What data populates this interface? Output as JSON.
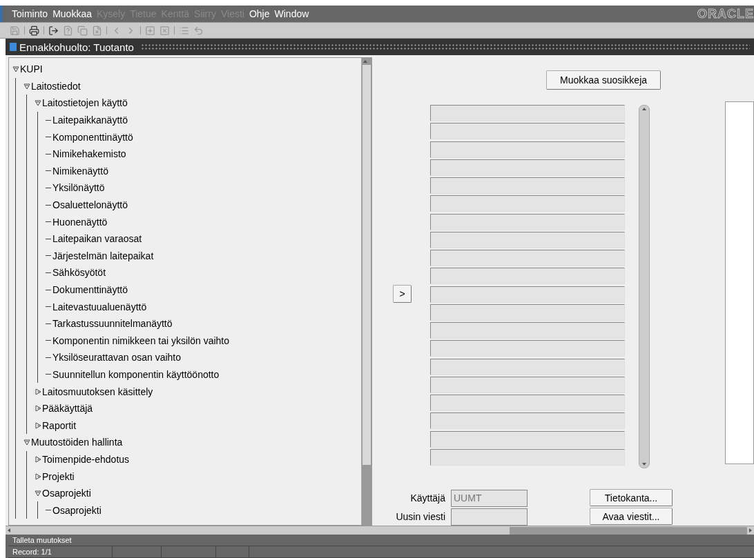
{
  "menu": [
    {
      "label": "Toiminto",
      "disabled": false
    },
    {
      "label": "Muokkaa",
      "disabled": false
    },
    {
      "label": "Kysely",
      "disabled": true
    },
    {
      "label": "Tietue",
      "disabled": true
    },
    {
      "label": "Kenttä",
      "disabled": true
    },
    {
      "label": "Siirry",
      "disabled": true
    },
    {
      "label": "Viesti",
      "disabled": true
    },
    {
      "label": "Ohje",
      "disabled": false
    },
    {
      "label": "Window",
      "disabled": false
    }
  ],
  "brand": "ORACLE",
  "window": {
    "title": "Ennakkohuolto: Tuotanto"
  },
  "tree": [
    {
      "label": "KUPI",
      "expanded": true,
      "children": [
        {
          "label": "Laitostiedot",
          "expanded": true,
          "children": [
            {
              "label": "Laitostietojen käyttö",
              "expanded": true,
              "children": [
                {
                  "label": "Laitepaikkanäyttö"
                },
                {
                  "label": "Komponenttinäyttö"
                },
                {
                  "label": "Nimikehakemisto"
                },
                {
                  "label": "Nimikenäyttö"
                },
                {
                  "label": "Yksilönäyttö"
                },
                {
                  "label": "Osaluettelonäyttö"
                },
                {
                  "label": "Huonenäyttö"
                },
                {
                  "label": "Laitepaikan varaosat"
                },
                {
                  "label": "Järjestelmän laitepaikat"
                },
                {
                  "label": "Sähkösyötöt"
                },
                {
                  "label": "Dokumenttinäyttö"
                },
                {
                  "label": "Laitevastuualuenäyttö"
                },
                {
                  "label": "Tarkastussuunnitelmanäyttö"
                },
                {
                  "label": "Komponentin nimikkeen tai yksilön vaihto"
                },
                {
                  "label": "Yksilöseurattavan osan vaihto"
                },
                {
                  "label": "Suunnitellun komponentin käyttöönotto"
                }
              ]
            },
            {
              "label": "Laitosmuutoksen käsittely",
              "expanded": false
            },
            {
              "label": "Pääkäyttäjä",
              "expanded": false
            },
            {
              "label": "Raportit",
              "expanded": false
            }
          ]
        },
        {
          "label": "Muutostöiden hallinta",
          "expanded": true,
          "children": [
            {
              "label": "Toimenpide-ehdotus",
              "expanded": false
            },
            {
              "label": "Projekti",
              "expanded": false
            },
            {
              "label": "Osaprojekti",
              "expanded": true,
              "children": [
                {
                  "label": "Osaprojekti"
                }
              ]
            }
          ]
        }
      ]
    }
  ],
  "favorites": {
    "edit_button": "Muokkaa suosikkeja",
    "move_button": ">"
  },
  "user": {
    "label": "Käyttäjä",
    "value": "UUMT"
  },
  "latest_message": {
    "label": "Uusin viesti"
  },
  "buttons": [
    "Tietokanta...",
    "Avaa viestit..."
  ],
  "status_bar": {
    "message": "Talleta muutokset",
    "record": "Record: 1/1"
  }
}
